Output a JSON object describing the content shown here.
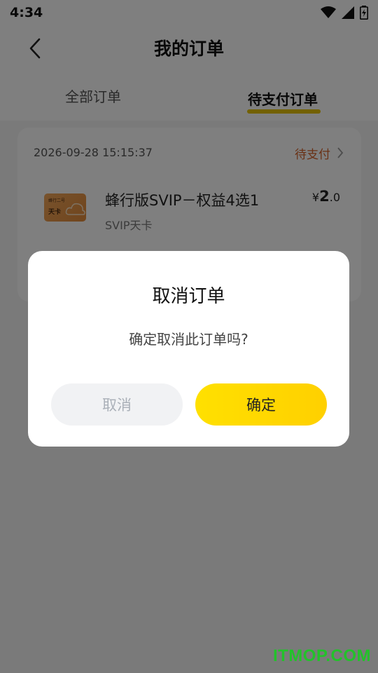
{
  "status_bar": {
    "time": "4:34"
  },
  "header": {
    "title": "我的订单"
  },
  "tabs": [
    {
      "label": "全部订单"
    },
    {
      "label": "待支付订单"
    }
  ],
  "order": {
    "time": "2026-09-28 15:15:37",
    "status": "待支付",
    "product": {
      "image_label": "天卡",
      "image_top_text": "蜂行二号",
      "name": "蜂行版SVIP－权益4选1",
      "sub": "SVIP天卡",
      "currency": "¥",
      "price_int": "2",
      "price_dec": ".0"
    }
  },
  "dialog": {
    "title": "取消订单",
    "message": "确定取消此订单吗?",
    "cancel_label": "取消",
    "confirm_label": "确定"
  },
  "watermark": "ITMOP.COM",
  "colors": {
    "accent": "#ffd800",
    "status": "#d4622a",
    "watermark": "#22c22a"
  }
}
